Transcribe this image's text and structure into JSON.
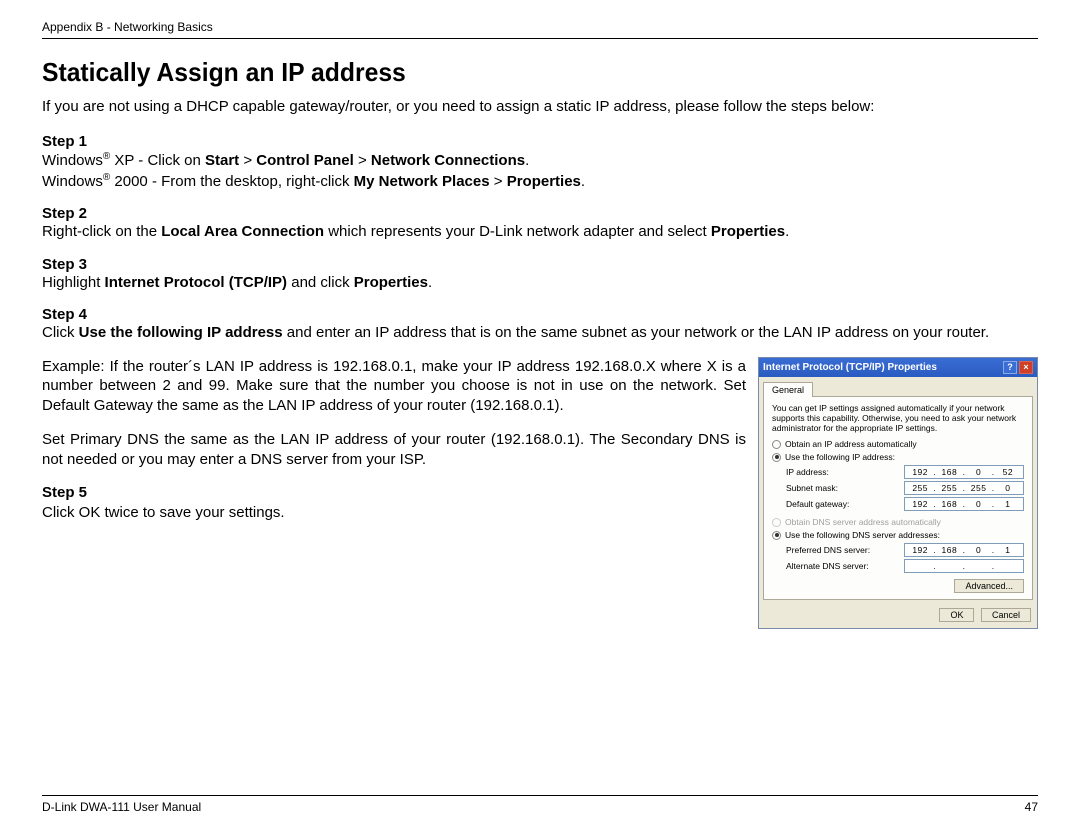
{
  "header": {
    "breadcrumb": "Appendix B - Networking Basics"
  },
  "title": "Statically Assign an IP address",
  "intro": "If you are not using a DHCP capable gateway/router, or you need to assign a static IP address, please follow the steps below:",
  "steps": {
    "s1": {
      "label": "Step 1",
      "xp_pre": "Windows",
      "xp_mid": " XP - Click on ",
      "xp_b1": "Start",
      "gt1": " > ",
      "xp_b2": "Control Panel",
      "gt2": " > ",
      "xp_b3": "Network Connections",
      "dot1": ".",
      "w2k_pre": "Windows",
      "w2k_mid": " 2000 - From the desktop, right-click ",
      "w2k_b1": "My Network Places",
      "gt3": " > ",
      "w2k_b2": "Properties",
      "dot2": "."
    },
    "s2": {
      "label": "Step 2",
      "t1": "Right-click on the ",
      "b1": "Local Area Connection",
      "t2": " which represents your D-Link network adapter and select ",
      "b2": "Properties",
      "dot": "."
    },
    "s3": {
      "label": "Step 3",
      "t1": "Highlight ",
      "b1": "Internet Protocol (TCP/IP)",
      "t2": " and click ",
      "b2": "Properties",
      "dot": "."
    },
    "s4": {
      "label": "Step 4",
      "t1": "Click ",
      "b1": "Use the following IP address",
      "t2": " and enter an IP address that is on the same subnet as your network or the LAN IP address on your router."
    },
    "example": "Example: If the router´s LAN IP address is 192.168.0.1, make your IP address 192.168.0.X where X is a number between 2 and 99. Make sure that the number you choose is not in use on the network. Set Default Gateway the same as the LAN IP address of your router (192.168.0.1).",
    "dns": "Set Primary DNS the same as the LAN IP address of your router (192.168.0.1). The Secondary DNS is not needed or you may enter a DNS server from your ISP.",
    "s5": {
      "label": "Step 5",
      "body": "Click OK twice to save your settings."
    }
  },
  "dialog": {
    "title": "Internet Protocol (TCP/IP) Properties",
    "tab": "General",
    "desc": "You can get IP settings assigned automatically if your network supports this capability. Otherwise, you need to ask your network administrator for the appropriate IP settings.",
    "r1": "Obtain an IP address automatically",
    "r2": "Use the following IP address:",
    "f_ip": "IP address:",
    "f_sm": "Subnet mask:",
    "f_gw": "Default gateway:",
    "v_ip": [
      "192",
      "168",
      "0",
      "52"
    ],
    "v_sm": [
      "255",
      "255",
      "255",
      "0"
    ],
    "v_gw": [
      "192",
      "168",
      "0",
      "1"
    ],
    "r3": "Obtain DNS server address automatically",
    "r4": "Use the following DNS server addresses:",
    "f_pd": "Preferred DNS server:",
    "f_ad": "Alternate DNS server:",
    "v_pd": [
      "192",
      "168",
      "0",
      "1"
    ],
    "v_ad": [
      "",
      "",
      "",
      ""
    ],
    "adv": "Advanced...",
    "ok": "OK",
    "cancel": "Cancel"
  },
  "footer": {
    "left": "D-Link DWA-111 User Manual",
    "right": "47"
  },
  "reg": "®"
}
